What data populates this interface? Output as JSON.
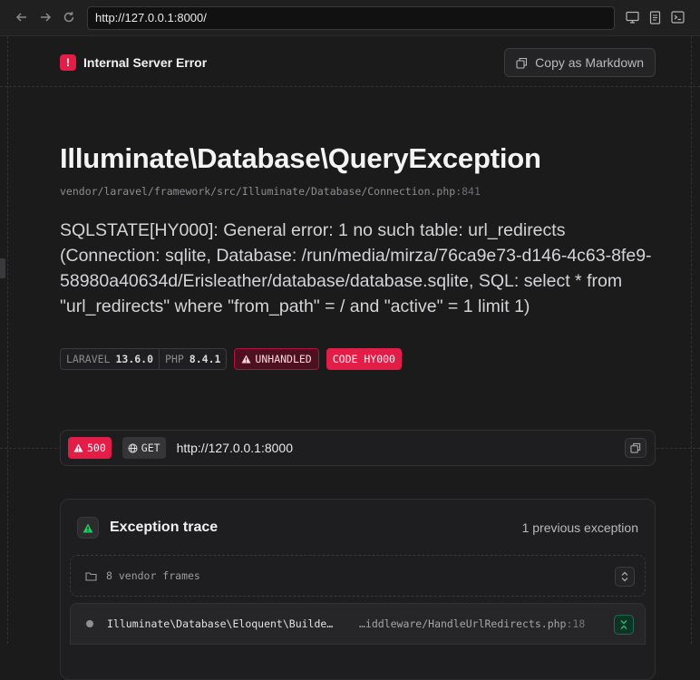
{
  "browser": {
    "url": "http://127.0.0.1:8000/"
  },
  "header": {
    "title": "Internal Server Error",
    "copy_button": "Copy as Markdown"
  },
  "exception": {
    "class": "Illuminate\\Database\\QueryException",
    "file": "vendor/laravel/framework/src/Illuminate/Database/Connection.php",
    "line": ":841",
    "message": "SQLSTATE[HY000]: General error: 1 no such table: url_redirects (Connection: sqlite, Database: /run/media/mirza/76ca9e73-d146-4c63-8fe9-58980a40634d/Erisleather/database/database.sqlite, SQL: select * from \"url_redirects\" where \"from_path\" = / and \"active\" = 1 limit 1)"
  },
  "badges": {
    "laravel_label": "LARAVEL",
    "laravel_version": "13.6.0",
    "php_label": "PHP",
    "php_version": "8.4.1",
    "unhandled": "UNHANDLED",
    "code": "CODE HY000"
  },
  "request": {
    "status": "500",
    "method": "GET",
    "url": "http://127.0.0.1:8000"
  },
  "trace": {
    "title": "Exception trace",
    "previous": "1 previous exception",
    "vendor_frames": "8 vendor frames",
    "frames": [
      {
        "class": "Illuminate\\Database\\Eloquent\\Builde…",
        "file": "…iddleware/HandleUrlRedirects.php",
        "line": ":18"
      }
    ]
  },
  "colors": {
    "accent_red": "#e11d48",
    "success_green": "#22c55e",
    "background": "#1b1b1c"
  }
}
